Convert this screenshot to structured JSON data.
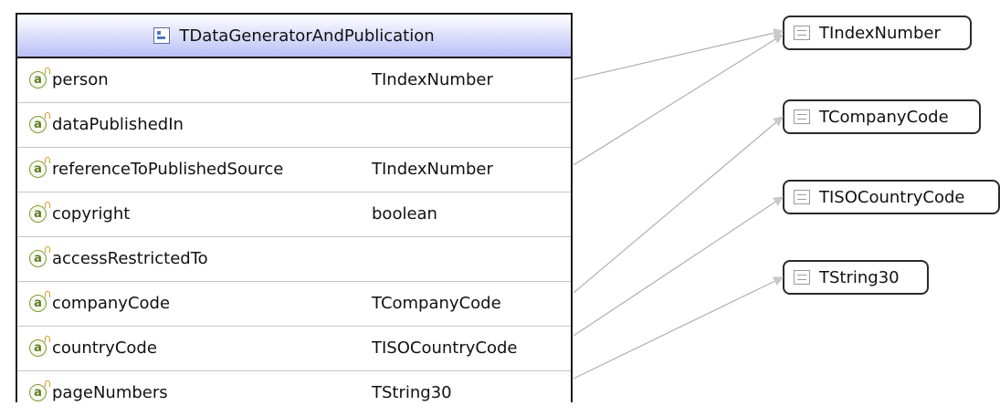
{
  "class_box": {
    "title": "TDataGeneratorAndPublication",
    "attributes": [
      {
        "name": "person",
        "type": "TIndexNumber"
      },
      {
        "name": "dataPublishedIn",
        "type": ""
      },
      {
        "name": "referenceToPublishedSource",
        "type": "TIndexNumber"
      },
      {
        "name": "copyright",
        "type": "boolean"
      },
      {
        "name": "accessRestrictedTo",
        "type": ""
      },
      {
        "name": "companyCode",
        "type": "TCompanyCode"
      },
      {
        "name": "countryCode",
        "type": "TISOCountryCode"
      },
      {
        "name": "pageNumbers",
        "type": "TString30"
      }
    ]
  },
  "type_boxes": [
    {
      "label": "TIndexNumber"
    },
    {
      "label": "TCompanyCode"
    },
    {
      "label": "TISOCountryCode"
    },
    {
      "label": "TString30"
    }
  ],
  "colors": {
    "header_gradient_end": "#b9bff5",
    "connector": "#b0b0b0"
  }
}
